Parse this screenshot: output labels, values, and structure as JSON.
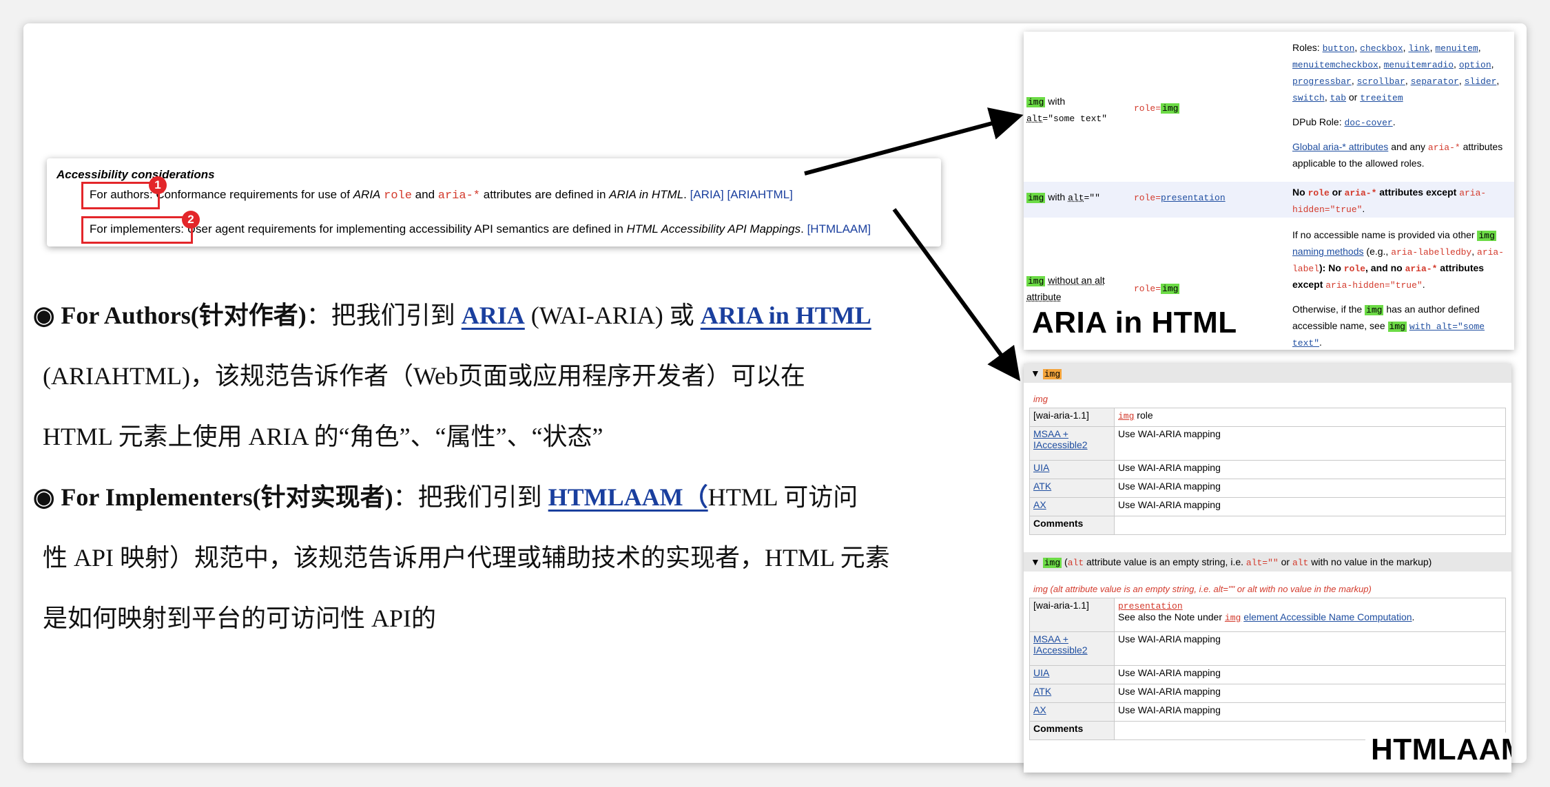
{
  "excerpt": {
    "title": "Accessibility considerations",
    "authors": {
      "label": "For authors",
      "tail": ": Conformance requirements for use of",
      "aria_in": "ARIA",
      "role": "role",
      "and": "and",
      "aria_star": "aria-*",
      "rest": "attributes are defined in",
      "spec": "ARIA in HTML",
      "ref1": "[ARIA]",
      "ref2": "[ARIAHTML]",
      "badge": "1"
    },
    "implementers": {
      "label": "For implementers",
      "tail": ": User agent requirements for implementing accessibility API semantics are defined in",
      "spec": "HTML Accessibility API Mappings",
      "ref": "[HTMLAAM]",
      "badge": "2"
    }
  },
  "commentary": {
    "p1_bullet": "◉ For Authors(针对作者)",
    "p1_a": "：把我们引到 ",
    "p1_link1": "ARIA",
    "p1_b": " (WAI-ARIA) 或 ",
    "p1_link2": "ARIA in HTML",
    "p2": "(ARIAHTML)，该规范告诉作者（Web页面或应用程序开发者）可以在",
    "p3": "HTML 元素上使用 ARIA 的“角色”、“属性”、“状态”",
    "p4_bullet": "◉ For Implementers(针对实现者)",
    "p4_a": "：把我们引到 ",
    "p4_link": "HTMLAAM（",
    "p4_b": "HTML 可访问",
    "p5": "性 API 映射）规范中，该规范告诉用户代理或辅助技术的实现者，HTML 元素",
    "p6": "是如何映射到平台的可访问性 API的"
  },
  "aria_panel": {
    "row1": {
      "img": "img",
      "with": "with",
      "alt": "alt",
      "alt_val": "=\"some text\"",
      "role_pre": "role=",
      "role_val": "img",
      "roles_label": "Roles:",
      "roles": [
        "button",
        "checkbox",
        "link",
        "menuitem",
        "menuitemcheckbox",
        "menuitemradio",
        "option",
        "progressbar",
        "scrollbar",
        "separator",
        "slider",
        "switch",
        "tab",
        "treeitem"
      ],
      "or": "or",
      "dpub_label": "DPub Role:",
      "dpub_role": "doc-cover",
      "global_link": "Global aria-* attributes",
      "global_tail": "and any",
      "global_code": "aria-*",
      "global_rest": "attributes applicable to the allowed roles."
    },
    "row2": {
      "img": "img",
      "with": "with",
      "alt": "alt",
      "alt_val": "=\"\"",
      "role_pre": "role=",
      "role_val": "presentation",
      "no": "No",
      "role": "role",
      "or": "or",
      "aria_star": "aria-*",
      "except": "attributes except",
      "hidden": "aria-hidden=\"true\"",
      "dot": "."
    },
    "row3": {
      "img": "img",
      "without": "without an alt attribute",
      "role_pre": "role=",
      "role_val": "img",
      "l1a": "If no accessible name is provided via other",
      "l2_link": "naming methods",
      "l2_rest": "(e.g.,",
      "labelledby": "aria-labelledby",
      "label": "aria-label",
      "l3_rest": "): No",
      "role": "role",
      "and_no": ", and no",
      "aria_star": "aria-*",
      "l4": "attributes except",
      "hidden": "aria-hidden=\"true\"",
      "o1": "Otherwise, if the",
      "o2": "has an author defined",
      "o3": "accessible name, see",
      "o_link": "with alt=\"some text\"",
      "dot": "."
    },
    "stamp": "ARIA in HTML"
  },
  "aam_panel": {
    "s1_tri": "▼",
    "s1_title": "img",
    "s1_sub": "img",
    "s1_rows": [
      {
        "k": "[wai-aria-1.1]",
        "v_code": "img",
        "v": " role"
      },
      {
        "k": "MSAA + IAccessible2",
        "v": "Use WAI-ARIA mapping"
      },
      {
        "k": "UIA",
        "v": "Use WAI-ARIA mapping"
      },
      {
        "k": "ATK",
        "v": "Use WAI-ARIA mapping"
      },
      {
        "k": "AX",
        "v": "Use WAI-ARIA mapping"
      },
      {
        "k": "Comments",
        "v": ""
      }
    ],
    "s2_tri": "▼",
    "s2_img": "img",
    "s2_a": "(",
    "s2_alt": "alt",
    "s2_b": "attribute value is an empty string, i.e.",
    "s2_code": "alt=\"\"",
    "s2_or": "or",
    "s2_alt2": "alt",
    "s2_c": "with no value in the markup)",
    "s2_sub": "img (alt attribute value is an empty string, i.e. alt=\"\" or alt with no value in the markup)",
    "s2_r1_k": "[wai-aria-1.1]",
    "s2_r1_v": "presentation",
    "s2_r1_note_a": "See also the Note under",
    "s2_r1_note_code": "img",
    "s2_r1_note_link": "element Accessible Name Computation",
    "s2_r1_note_dot": ".",
    "s2_rows": [
      {
        "k": "MSAA + IAccessible2",
        "v": "Use WAI-ARIA mapping"
      },
      {
        "k": "UIA",
        "v": "Use WAI-ARIA mapping"
      },
      {
        "k": "ATK",
        "v": "Use WAI-ARIA mapping"
      },
      {
        "k": "AX",
        "v": "Use WAI-ARIA mapping"
      },
      {
        "k": "Comments",
        "v": ""
      }
    ],
    "stamp": "HTMLAAM"
  }
}
